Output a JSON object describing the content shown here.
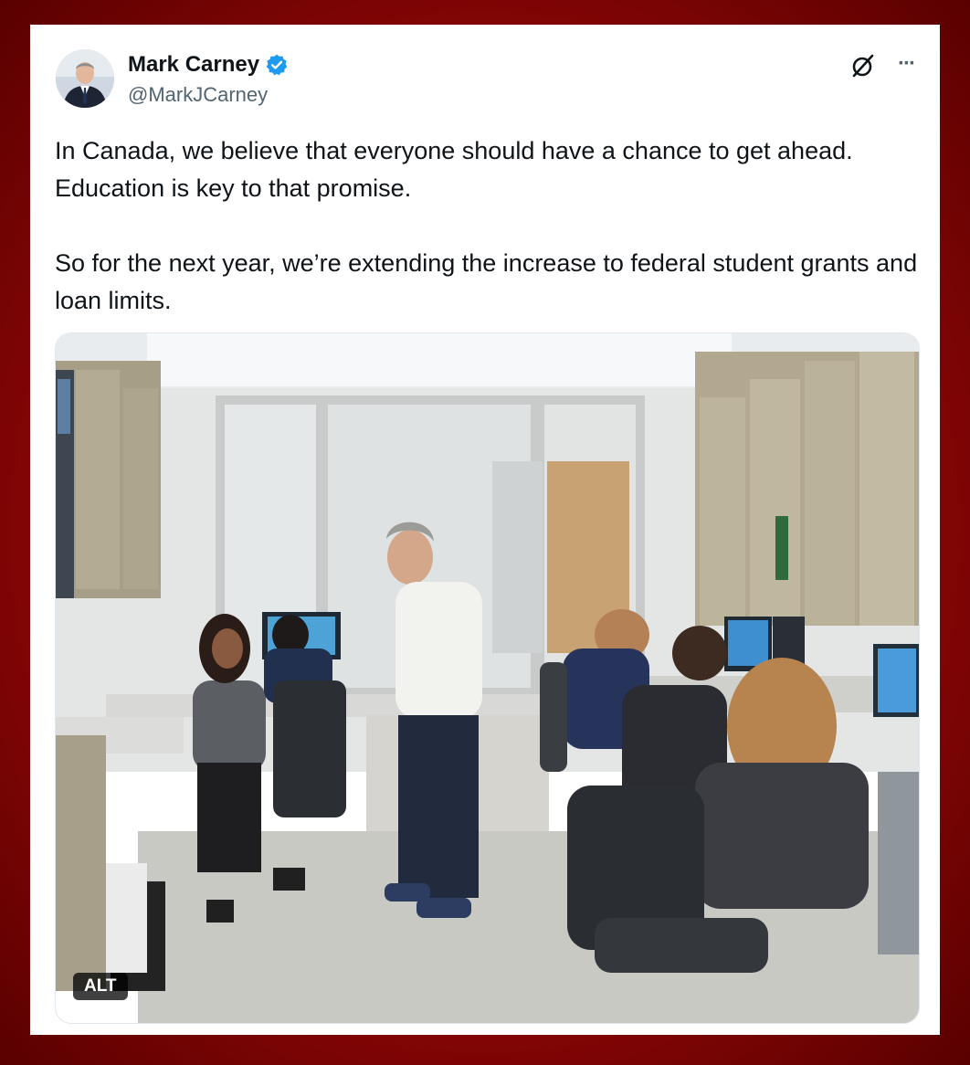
{
  "author": {
    "name": "Mark Carney",
    "handle": "@MarkJCarney",
    "verified_icon": "verified-badge-icon",
    "verified_color": "#1d9bf0"
  },
  "tweet": {
    "paragraph_1": "In Canada, we believe that everyone should have a chance to get ahead. Education is key to that promise.",
    "paragraph_2": "So for the next year, we’re extending the increase to federal student grants and loan limits."
  },
  "media": {
    "alt_label": "ALT"
  },
  "icons": {
    "grok": "grok-icon",
    "more": "more-options-icon"
  }
}
